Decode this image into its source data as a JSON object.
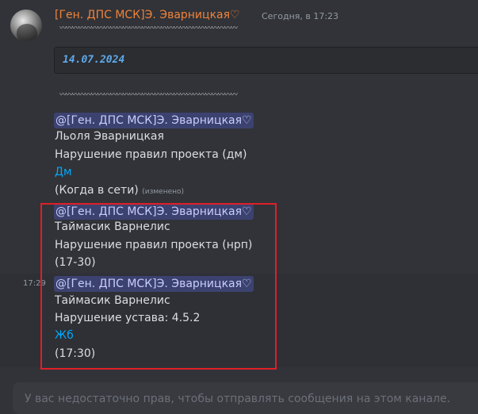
{
  "message": {
    "author": "[Ген. ДПС МСК]Э. Эварницкая♡",
    "timestamp": "Сегодня, в 17:23",
    "divider": "〰〰〰〰〰〰〰〰〰〰〰〰〰〰〰〰〰〰〰〰〰〰〰〰〰〰〰〰",
    "date_code": "14.07.2024",
    "blocks": [
      {
        "mention": "@[Ген. ДПС МСК]Э. Эварницкая♡",
        "name": "Льоля Эварницкая",
        "violation": "Нарушение правил проекта (дм)",
        "link": "Дм",
        "time": "(Когда в сети)",
        "edited": "(изменено)"
      },
      {
        "mention": "@[Ген. ДПС МСК]Э. Эварницкая♡",
        "name": "Таймасик Варнелис",
        "violation": "Нарушение правил проекта (нрп)",
        "time": "(17-30)"
      },
      {
        "mention": "@[Ген. ДПС МСК]Э. Эварницкая♡",
        "name": "Таймасик Варнелис",
        "violation": "Нарушение устава: 4.5.2",
        "link": "Жб",
        "time": "(17:30)"
      }
    ],
    "side_timestamp": "17:29"
  },
  "composer": {
    "notice": "У вас недостаточно прав, чтобы отправлять сообщения на этом канале."
  },
  "colors": {
    "background": "#313338",
    "author": "#f0833a",
    "mention_bg": "#3c4270",
    "link": "#00a8fc",
    "highlight_box": "#e01f27"
  }
}
